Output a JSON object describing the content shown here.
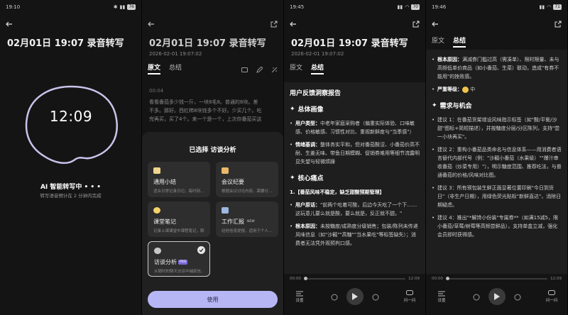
{
  "colors": {
    "accent": "#b7b6f5",
    "bg": "#141414",
    "card": "#2e2e2e"
  },
  "panel1": {
    "status": {
      "time": "19:10",
      "battery": "76"
    },
    "title": "02月01日 19:07 录音转写",
    "timer": "12:09",
    "status_text": "AI 智能转写中 • • •",
    "sub_text": "转写语音预计在 2 分钟内完成"
  },
  "panel2": {
    "title": "02月01日 19:07 录音转写",
    "date": "2026-02-01 19:07:02",
    "tabs": [
      "原文",
      "总结"
    ],
    "transcript": {
      "timestamp": "00:04",
      "lines": [
        "看看番茄多少钱一斤，一块8毛8。普通的8块。差",
        "不多。那好。西红柿8块钱多个不好。少买几个。吃",
        "完再买，买了4个。来一个是一个，上次你番茄买这"
      ]
    },
    "sheet": {
      "title": "已选择 访谈分析",
      "cards": [
        {
          "title": "通用小结",
          "desc": "适合日常记录日记，每时刻..."
        },
        {
          "title": "会议纪要",
          "desc": "根据会议讨论内容，需要讨..."
        },
        {
          "title": "课堂笔记",
          "desc": "记录上课课堂中课程笔记，聊..."
        },
        {
          "title": "工作汇报",
          "desc": "经他信息提报，适用于个人...",
          "badge": "NEW"
        },
        {
          "title": "访谈分析",
          "desc": "从随时的聊天访谈中捕捉信...",
          "badge": "PRO"
        }
      ],
      "use_label": "使用"
    }
  },
  "panel3": {
    "status": {
      "time": "19:45",
      "battery": "70"
    },
    "title": "02月01日 19:07 录音转写",
    "date": "2026-02-01 19:07:02",
    "tabs": [
      "原文",
      "总结"
    ],
    "report_title": "用户反馈洞察报告",
    "sec1": "总体画像",
    "b1_label": "用户类型：",
    "b1_text": "中老年家庭采购者（偏重实际体验、口味敏感、价格敏感、习惯性对比、重视新鲜度与\"当季感\"）",
    "b2_label": "情绪基调：",
    "b2_text": "整体务实平和，但对番茄酸涩、小番茄价高不耐、生姜无味、带鱼日期模糊、促销券难用等细节流露明显失望与轻微烦躁",
    "sec2": "核心痛点",
    "pain1": "1.【番茄风味不稳定，缺乏甜酸预期管理】",
    "b3_label": "用户原话：",
    "b3_text": "\"前两个吃着可酸，后边今天吃了一个下……这玩意儿要么就是酸，要么就是，反正就不甜。\"",
    "b4_label": "根本原因：",
    "b4_text": "未按糖度/成熟度分级销售；包装/陈列未传递风味信息（如\"沙瓤\"\"高糖\"\"当水果吃\"等标签缺失）；消费者无法凭外观预判口感。",
    "player": {
      "start": "00:00",
      "end": "12:09",
      "left_label": "设置",
      "right_label": "问一问"
    }
  },
  "panel4": {
    "status": {
      "time": "19:46",
      "battery": "71"
    },
    "tabs": [
      "原文",
      "总结"
    ],
    "b1_label": "根本原因：",
    "b1_text": "满减券门槛过高（需凑单）、限时限量、未与高频低单价商品（如小番茄、生菜）联动，造成\"有券不能用\"的挫败感。",
    "severity_label": "严重等级：",
    "severity_text": "中",
    "sec": "需求与机会",
    "items": [
      "建议 1：在番茄货架增设风味指示标签（如\"酸/平衡/沙甜\"图标+简短描述），并按糖度分层/分区陈列，支持\"尝一小块再买\"。",
      "建议 2：重构小番茄品类命名与信息体系——用消费者语言替代内部代号（例：\"沙瓤小番茄（水果级）\"\"爆汁串收番茄（炒菜专用）\"），明示糖度范围、推荐吃法，与普通番茄的价格/风味对比图。",
      "建议 3：所有预包装生鲜正面显著位置印刷\"今日到货日\"（非生产日期），用绿色荧光贴标\"新鲜直达\"，消除日期疑虑。",
      "建议 4：推出\"*解馋小份装\"专属券**（如满15减5，限小番茄/草莓/树莓等高频尝鲜品），支持单盒立减，强化会员即时获得感。"
    ],
    "player": {
      "start": "00:00",
      "end": "12:09",
      "left_label": "设置",
      "right_label": "问一问"
    }
  }
}
